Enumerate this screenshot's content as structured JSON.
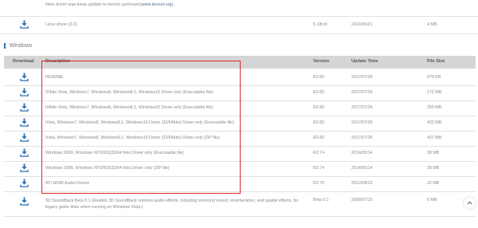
{
  "top_row": {
    "description_prefix": "New driver was keep update to kernel upstream(",
    "description_link": "www.kernel.org",
    "description_suffix": ")."
  },
  "linux_row": {
    "description": "Linux driver (3.0)",
    "version": "5.18rc8",
    "update_time": "2014/05/21",
    "file_size": "4 MB"
  },
  "section": {
    "title": "Windows"
  },
  "table": {
    "headers": {
      "download": "Download",
      "description": "Description",
      "version": "Version",
      "update_time": "Update Time",
      "file_size": "File Size"
    },
    "rows": [
      {
        "description": "README",
        "version": "R2.82",
        "update_time": "2017/07/26",
        "file_size": "979 KB"
      },
      {
        "description": "32bits Vista, Windows7, Windows8, Windows8.1, Windows10 Driver only (Executable file)",
        "version": "R2.82",
        "update_time": "2017/07/26",
        "file_size": "172 MB"
      },
      {
        "description": "64bits Vista, Windows7, Windows8, Windows8.1, Windows10 Driver only (Executable file)",
        "version": "R2.82",
        "update_time": "2017/07/26",
        "file_size": "259 MB"
      },
      {
        "description": "Vista, Windows7, Windows8, Windows8.1, Windows10 Driver (32/64bits) Driver only (Executable file)",
        "version": "R2.82",
        "update_time": "2017/07/26",
        "file_size": "422 MB"
      },
      {
        "description": "Vista, Windows7, Windows8, Windows8.1, Windows10 Driver (32/64bits) Driver only (ZIP file)",
        "version": "R2.82",
        "update_time": "2017/07/26",
        "file_size": "427 MB"
      },
      {
        "description": "Windows 2000, Windows XP/2003(32/64 bits) Driver only (Executable file)",
        "version": "R2.74",
        "update_time": "2014/05/14",
        "file_size": "30 MB"
      },
      {
        "description": "Windows 2000, Windows XP/2003(32/64 bits) Driver only (ZIP file)",
        "version": "R2.74",
        "update_time": "2014/05/14",
        "file_size": "30 MB"
      },
      {
        "description": "ATI HDMI Audio Device",
        "version": "R2.70",
        "update_time": "2012/08/22",
        "file_size": "22 MB"
      },
      {
        "description": "3D SoundBack Beta 0.1 (Realtek 3D SoundBack restores audio effects, including surround sound, reverberation, and spatial effects, for legacy game titles when running on Windows Vista.)",
        "version": "Beta 0.1",
        "update_time": "2008/07/15",
        "file_size": "6 MB"
      }
    ]
  },
  "icons": {
    "download": "download-arrow-icon",
    "scroll_top": "chevron-up-icon"
  },
  "colors": {
    "accent": "#2d6fb4",
    "header_bg": "#d5d5d5",
    "highlight_border": "#d62b2b"
  }
}
